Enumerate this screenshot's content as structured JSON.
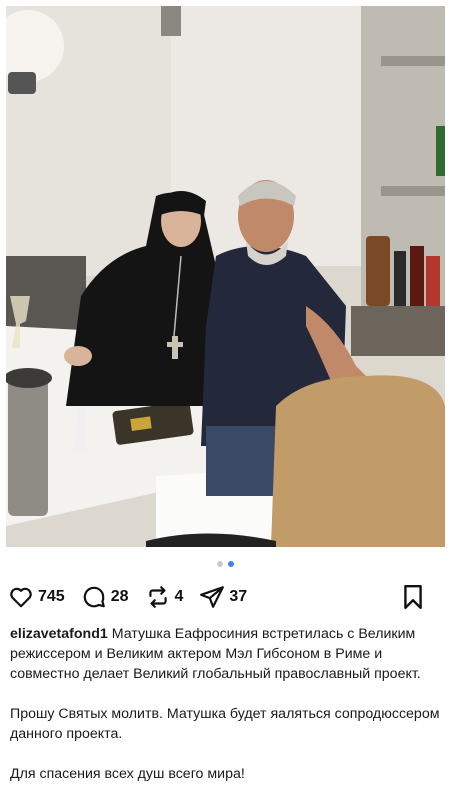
{
  "post": {
    "username": "elizavetafond1",
    "caption_p1": "Матушка Еафросиния встретилась с Великим режиссером и Великим актером Мэл Гибсоном в Риме и совместно делает Великий глобальный православный проект.",
    "caption_p2": "Прошу Святых молитв. Матушка будет яаляться сопродюссером данного проекта.",
    "caption_p3": "Для спасения всех душ всего мира!"
  },
  "actions": {
    "likes": "745",
    "comments": "28",
    "reposts": "4",
    "shares": "37"
  },
  "carousel": {
    "total": 2,
    "active_index": 1
  },
  "icons": {
    "like": "heart-icon",
    "comment": "comment-bubble-icon",
    "repost": "repost-arrows-icon",
    "share": "paper-plane-icon",
    "save": "bookmark-icon"
  },
  "colors": {
    "active_dot": "#3b82f6",
    "inactive_dot": "#c9c9c9"
  }
}
